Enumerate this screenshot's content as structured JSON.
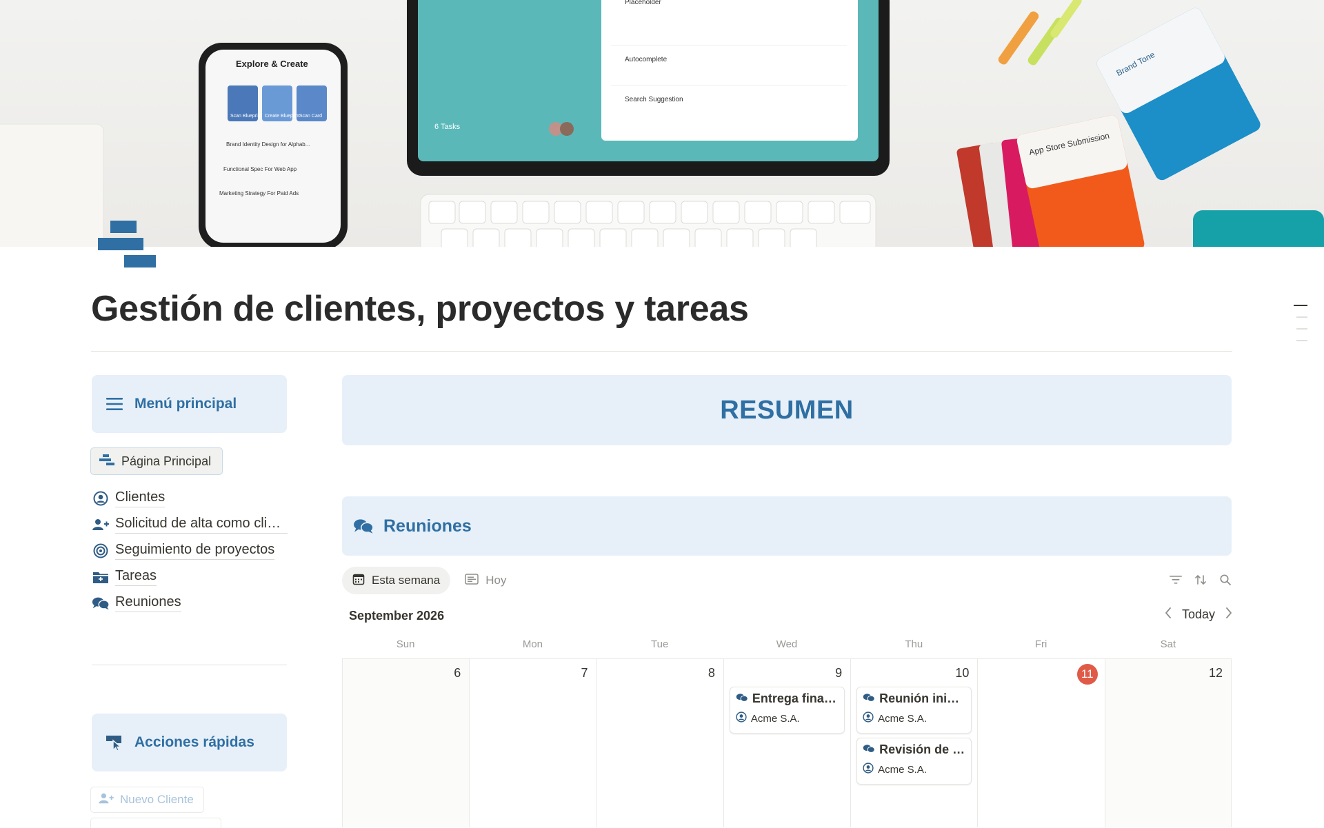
{
  "page": {
    "title": "Gestión de clientes, proyectos y tareas"
  },
  "cover": {
    "phone": {
      "heading": "Explore & Create",
      "tiles": [
        "Scan Blueprint",
        "Create Blueprint",
        "Scan Card"
      ],
      "items": [
        "Brand Identity Design for Alphab...",
        "Functional Spec For Web App",
        "Marketing Strategy For Paid Ads"
      ]
    },
    "tablet": {
      "list_items": [
        "Placeholder",
        "Autocomplete",
        "Search Suggestion"
      ],
      "tasks": "6 Tasks"
    },
    "cards": {
      "back": "Brand Tone",
      "front": "App Store Submission"
    }
  },
  "sidebar": {
    "menu_title": "Menú principal",
    "home_button": "Página Principal",
    "items": [
      {
        "label": "Clientes",
        "icon": "user-circle-icon"
      },
      {
        "label": "Solicitud de alta como cliente",
        "icon": "user-plus-icon"
      },
      {
        "label": "Seguimiento de proyectos",
        "icon": "target-icon"
      },
      {
        "label": "Tareas",
        "icon": "folder-plus-icon"
      },
      {
        "label": "Reuniones",
        "icon": "chat-bubbles-icon"
      }
    ],
    "quick_actions_title": "Acciones rápidas",
    "new_client_button": "Nuevo Cliente"
  },
  "main": {
    "summary_title": "RESUMEN",
    "meetings_title": "Reuniones",
    "views": [
      {
        "label": "Esta semana",
        "active": true
      },
      {
        "label": "Hoy",
        "active": false
      }
    ],
    "calendar": {
      "month_label": "September 2026",
      "today_button": "Today",
      "weekdays": [
        "Sun",
        "Mon",
        "Tue",
        "Wed",
        "Thu",
        "Fri",
        "Sat"
      ],
      "dates": [
        "6",
        "7",
        "8",
        "9",
        "10",
        "11",
        "12"
      ],
      "today_date": "11",
      "events": {
        "wed": [
          {
            "title": "Entrega final de proyecto",
            "client": "Acme S.A."
          }
        ],
        "thu": [
          {
            "title": "Reunión inicial de proyecto",
            "client": "Acme S.A."
          },
          {
            "title": "Revisión de lanzamiento",
            "client": "Acme S.A."
          }
        ]
      }
    }
  },
  "colors": {
    "accent": "#2f6fa3",
    "callout_bg": "#e7f0f8",
    "today": "#e05a47"
  }
}
